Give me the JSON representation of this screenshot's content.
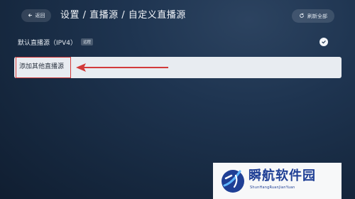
{
  "header": {
    "back_label": "返回",
    "title": "设置 / 直播源 / 自定义直播源",
    "refresh_label": "刷新全部"
  },
  "default_source": {
    "label": "默认直播源（IPV4）",
    "badge": "远程",
    "selected": true
  },
  "add_source": {
    "label": "添加其他直播源"
  },
  "watermark": {
    "title": "瞬航软件园",
    "subtitle": "ShunHangRuanJianYuan"
  },
  "colors": {
    "background": "#1e3450",
    "highlight": "#d23a3a",
    "row_bg": "#e8ecf1",
    "watermark_text": "#1f3f95"
  }
}
